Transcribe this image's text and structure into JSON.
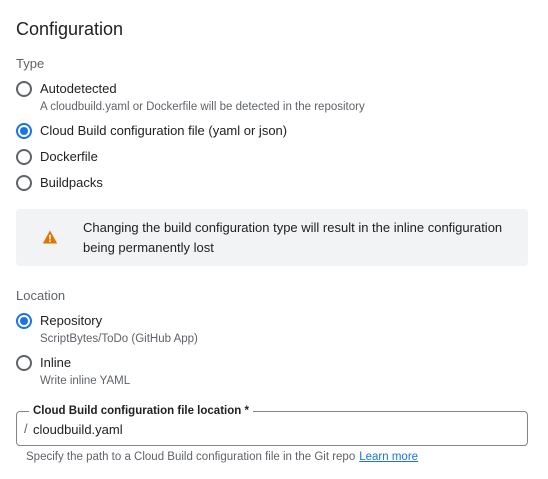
{
  "title": "Configuration",
  "type_section": {
    "label": "Type",
    "options": [
      {
        "label": "Autodetected",
        "description": "A cloudbuild.yaml or Dockerfile will be detected in the repository",
        "checked": false
      },
      {
        "label": "Cloud Build configuration file (yaml or json)",
        "description": "",
        "checked": true
      },
      {
        "label": "Dockerfile",
        "description": "",
        "checked": false
      },
      {
        "label": "Buildpacks",
        "description": "",
        "checked": false
      }
    ]
  },
  "warning": {
    "icon": "warning-icon",
    "color": "#e37400",
    "text": "Changing the build configuration type will result in the inline configuration being permanently lost"
  },
  "location_section": {
    "label": "Location",
    "options": [
      {
        "label": "Repository",
        "description": "ScriptBytes/ToDo (GitHub App)",
        "checked": true
      },
      {
        "label": "Inline",
        "description": "Write inline YAML",
        "checked": false
      }
    ]
  },
  "config_file_field": {
    "label": "Cloud Build configuration file location *",
    "prefix": "/",
    "value": "cloudbuild.yaml"
  },
  "helper": {
    "text": "Specify the path to a Cloud Build configuration file in the Git repo",
    "link": "Learn more"
  },
  "colors": {
    "accent": "#1a73e8",
    "warning": "#e37400"
  }
}
